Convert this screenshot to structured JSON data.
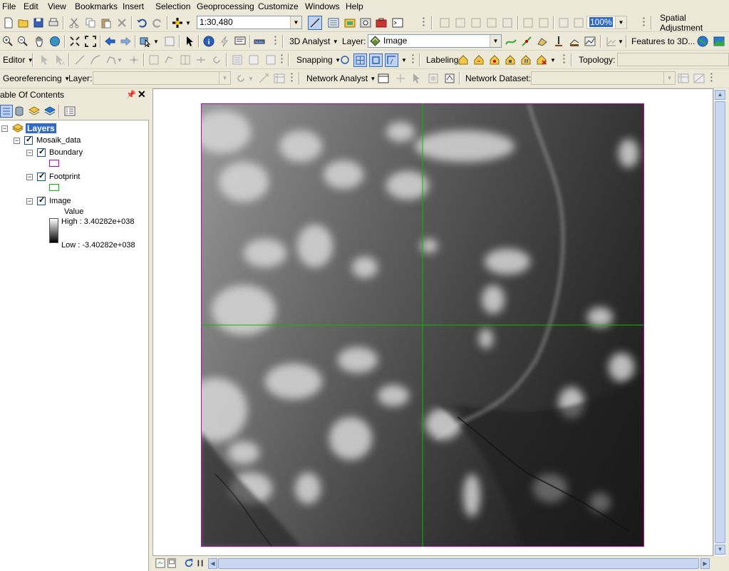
{
  "menu": [
    "File",
    "Edit",
    "View",
    "Bookmarks",
    "Insert",
    "Selection",
    "Geoprocessing",
    "Customize",
    "Windows",
    "Help"
  ],
  "standard_toolbar": {
    "scale_value": "1:30,480",
    "zoom_value": "100%",
    "spatial_adjustment_label": "Spatial Adjustment"
  },
  "tools_toolbar": {
    "analyst_label": "3D Analyst",
    "layer_label": "Layer:",
    "layer_value": "Image",
    "features_to_3d_label": "Features to 3D..."
  },
  "editor_toolbar": {
    "editor_label": "Editor",
    "snapping_label": "Snapping",
    "labeling_label": "Labeling",
    "topology_label": "Topology:",
    "topology_value": ""
  },
  "georef_toolbar": {
    "georeferencing_label": "Georeferencing",
    "layer_label": "Layer:",
    "layer_value": "",
    "network_analyst_label": "Network Analyst",
    "network_dataset_label": "Network Dataset:",
    "network_dataset_value": ""
  },
  "toc": {
    "title": "able Of Contents",
    "root_label": "Layers",
    "group_label": "Mosaik_data",
    "layers": [
      {
        "name": "Boundary",
        "symbol_color": "#c000c0"
      },
      {
        "name": "Footprint",
        "symbol_color": "#00c000"
      },
      {
        "name": "Image"
      }
    ],
    "image_legend": {
      "field": "Value",
      "high": "High : 3.40282e+038",
      "low": "Low : -3.40282e+038"
    }
  },
  "map": {
    "boundary_color": "#c000c0",
    "footprint_color": "#00c000"
  },
  "colors": {
    "chrome": "#ece9d8",
    "selection": "#316ac5"
  }
}
